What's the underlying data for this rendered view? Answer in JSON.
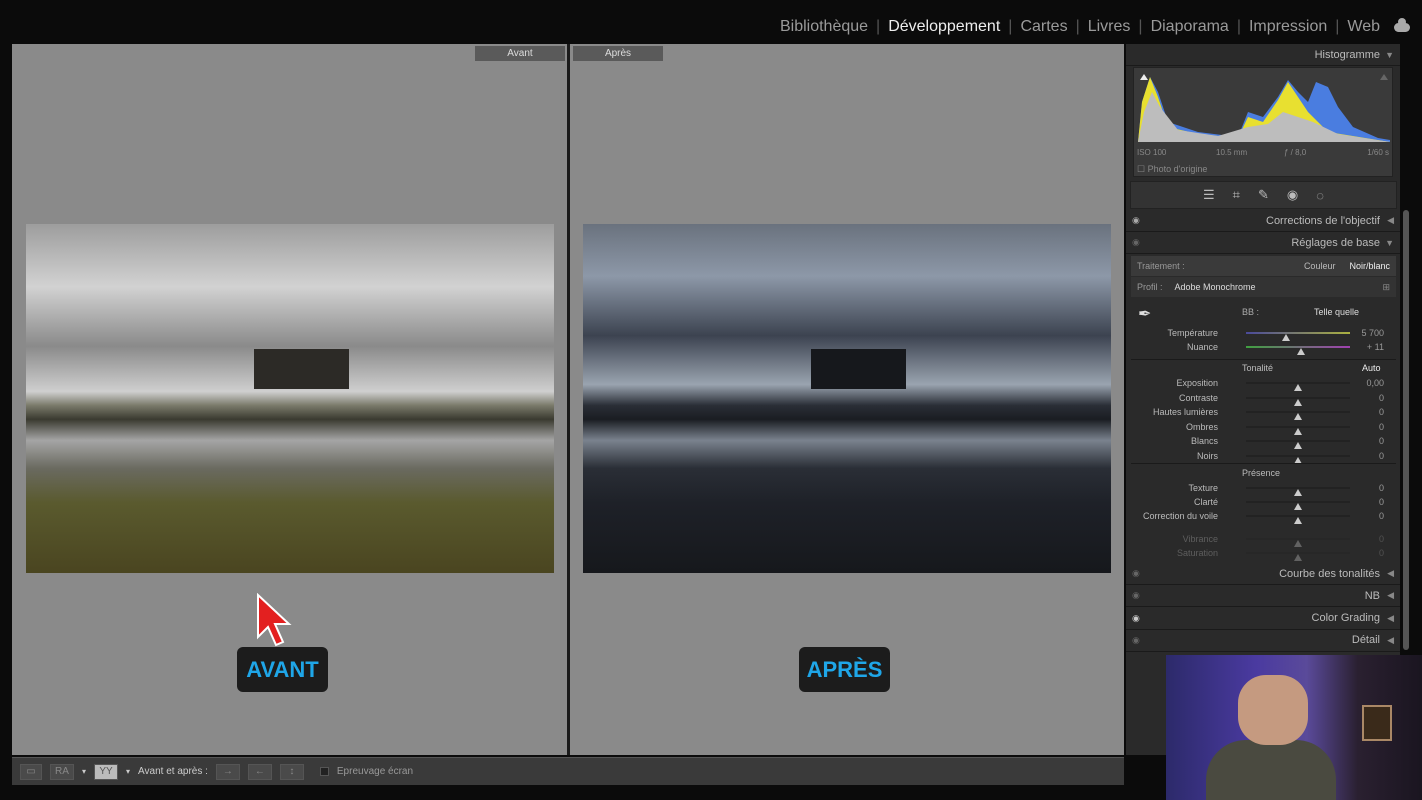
{
  "modules": [
    {
      "label": "Bibliothèque",
      "active": false
    },
    {
      "label": "Développement",
      "active": true
    },
    {
      "label": "Cartes",
      "active": false
    },
    {
      "label": "Livres",
      "active": false
    },
    {
      "label": "Diaporama",
      "active": false
    },
    {
      "label": "Impression",
      "active": false
    },
    {
      "label": "Web",
      "active": false
    }
  ],
  "view": {
    "before_tag": "Avant",
    "after_tag": "Après",
    "before_badge": "AVANT",
    "after_badge": "APRÈS",
    "badge_color": "#1fa6e8"
  },
  "toolbar": {
    "before_after_label": "Avant et après :",
    "proof_label": "Epreuvage écran",
    "ra_label": "RA",
    "yy_label": "YY"
  },
  "panel": {
    "histogram": {
      "title": "Histogramme",
      "iso": "ISO 100",
      "focal": "10.5 mm",
      "aperture": "ƒ / 8,0",
      "shutter": "1/60 s",
      "original_photo": "Photo d'origine"
    },
    "lens_corrections": "Corrections de l'objectif",
    "basic": {
      "title": "Réglages de base",
      "treatment_label": "Traitement :",
      "color": "Couleur",
      "bw": "Noir/blanc",
      "profile_label": "Profil :",
      "profile": "Adobe Monochrome",
      "wb_label": "BB :",
      "wb_value": "Telle quelle",
      "tone_label": "Tonalité",
      "auto": "Auto",
      "presence_label": "Présence",
      "sliders_wb": [
        {
          "label": "Température",
          "value": "5 700",
          "pos": 0.38
        },
        {
          "label": "Nuance",
          "value": "+ 11",
          "pos": 0.53
        }
      ],
      "sliders_tone": [
        {
          "label": "Exposition",
          "value": "0,00",
          "pos": 0.5
        },
        {
          "label": "Contraste",
          "value": "0",
          "pos": 0.5
        },
        {
          "label": "Hautes lumières",
          "value": "0",
          "pos": 0.5
        },
        {
          "label": "Ombres",
          "value": "0",
          "pos": 0.5
        },
        {
          "label": "Blancs",
          "value": "0",
          "pos": 0.5
        },
        {
          "label": "Noirs",
          "value": "0",
          "pos": 0.5
        }
      ],
      "sliders_presence": [
        {
          "label": "Texture",
          "value": "0",
          "pos": 0.5
        },
        {
          "label": "Clarté",
          "value": "0",
          "pos": 0.5
        },
        {
          "label": "Correction du voile",
          "value": "0",
          "pos": 0.5
        }
      ],
      "sliders_disabled": [
        {
          "label": "Vibrance",
          "value": "0",
          "pos": 0.5
        },
        {
          "label": "Saturation",
          "value": "0",
          "pos": 0.5
        }
      ]
    },
    "sections": [
      "Courbe des tonalités",
      "NB",
      "Color Grading",
      "Détail"
    ]
  }
}
